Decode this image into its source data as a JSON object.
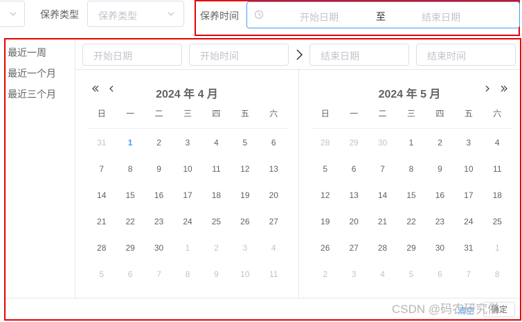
{
  "filters": {
    "type_label": "保养类型",
    "type_placeholder": "保养类型",
    "time_label": "保养时间",
    "start_placeholder": "开始日期",
    "range_separator": "至",
    "end_placeholder": "结束日期"
  },
  "picker": {
    "shortcuts": [
      "最近一周",
      "最近一个月",
      "最近三个月"
    ],
    "start_date_placeholder": "开始日期",
    "start_time_placeholder": "开始时间",
    "end_date_placeholder": "结束日期",
    "end_time_placeholder": "结束时间",
    "weekdays": [
      "日",
      "一",
      "二",
      "三",
      "四",
      "五",
      "六"
    ],
    "left_month": {
      "title": "2024 年 4 月",
      "days": [
        {
          "d": "31",
          "muted": true
        },
        {
          "d": "1",
          "today": true
        },
        {
          "d": "2"
        },
        {
          "d": "3"
        },
        {
          "d": "4"
        },
        {
          "d": "5"
        },
        {
          "d": "6"
        },
        {
          "d": "7"
        },
        {
          "d": "8"
        },
        {
          "d": "9"
        },
        {
          "d": "10"
        },
        {
          "d": "11"
        },
        {
          "d": "12"
        },
        {
          "d": "13"
        },
        {
          "d": "14"
        },
        {
          "d": "15"
        },
        {
          "d": "16"
        },
        {
          "d": "17"
        },
        {
          "d": "18"
        },
        {
          "d": "19"
        },
        {
          "d": "20"
        },
        {
          "d": "21"
        },
        {
          "d": "22"
        },
        {
          "d": "23"
        },
        {
          "d": "24"
        },
        {
          "d": "25"
        },
        {
          "d": "26"
        },
        {
          "d": "27"
        },
        {
          "d": "28"
        },
        {
          "d": "29"
        },
        {
          "d": "30"
        },
        {
          "d": "1",
          "muted": true
        },
        {
          "d": "2",
          "muted": true
        },
        {
          "d": "3",
          "muted": true
        },
        {
          "d": "4",
          "muted": true
        },
        {
          "d": "5",
          "muted": true
        },
        {
          "d": "6",
          "muted": true
        },
        {
          "d": "7",
          "muted": true
        },
        {
          "d": "8",
          "muted": true
        },
        {
          "d": "9",
          "muted": true
        },
        {
          "d": "10",
          "muted": true
        },
        {
          "d": "11",
          "muted": true
        }
      ]
    },
    "right_month": {
      "title": "2024 年 5 月",
      "days": [
        {
          "d": "28",
          "muted": true
        },
        {
          "d": "29",
          "muted": true
        },
        {
          "d": "30",
          "muted": true
        },
        {
          "d": "1"
        },
        {
          "d": "2"
        },
        {
          "d": "3"
        },
        {
          "d": "4"
        },
        {
          "d": "5"
        },
        {
          "d": "6"
        },
        {
          "d": "7"
        },
        {
          "d": "8"
        },
        {
          "d": "9"
        },
        {
          "d": "10"
        },
        {
          "d": "11"
        },
        {
          "d": "12"
        },
        {
          "d": "13"
        },
        {
          "d": "14"
        },
        {
          "d": "15"
        },
        {
          "d": "16"
        },
        {
          "d": "17"
        },
        {
          "d": "18"
        },
        {
          "d": "19"
        },
        {
          "d": "20"
        },
        {
          "d": "21"
        },
        {
          "d": "22"
        },
        {
          "d": "23"
        },
        {
          "d": "24"
        },
        {
          "d": "25"
        },
        {
          "d": "26"
        },
        {
          "d": "27"
        },
        {
          "d": "28"
        },
        {
          "d": "29"
        },
        {
          "d": "30"
        },
        {
          "d": "31"
        },
        {
          "d": "1",
          "muted": true
        },
        {
          "d": "2",
          "muted": true
        },
        {
          "d": "3",
          "muted": true
        },
        {
          "d": "4",
          "muted": true
        },
        {
          "d": "5",
          "muted": true
        },
        {
          "d": "6",
          "muted": true
        },
        {
          "d": "7",
          "muted": true
        },
        {
          "d": "8",
          "muted": true
        }
      ]
    },
    "clear_label": "清空",
    "confirm_label": "确定"
  },
  "watermark": "CSDN @码农研究僧",
  "colors": {
    "accent": "#409eff",
    "highlight_border": "#e60000",
    "muted_text": "#c0c4cc"
  }
}
